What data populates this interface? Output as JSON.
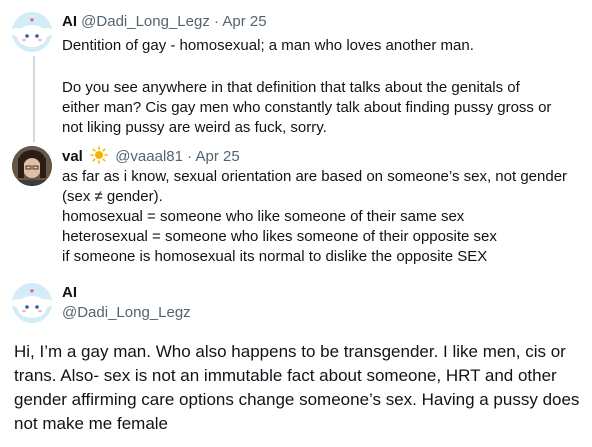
{
  "tweet1": {
    "name": "AI",
    "handle": "@Dadi_Long_Legz",
    "sep": "·",
    "date": "Apr 25",
    "line1": "Dentition of gay - homosexual; a man who loves another man.",
    "line2": "Do you see anywhere in that definition that talks about the genitals of",
    "line3": "either man? Cis gay men who constantly talk about finding pussy gross or",
    "line4": "not liking pussy are weird as fuck, sorry.",
    "avatar_icon": "cinnamoroll-avatar-icon"
  },
  "tweet2": {
    "name": "val",
    "emoji": "sun-icon",
    "handle": "@vaaal81",
    "sep": "·",
    "date": "Apr 25",
    "line1": "as far as i know, sexual orientation are based on someone’s sex, not gender",
    "line2": "(sex ≠ gender).",
    "line3": "homosexual = someone who like someone of their same sex",
    "line4": "heterosexual = someone who likes someone of their opposite sex",
    "line5": "if someone is homosexual its normal to dislike the opposite SEX",
    "avatar_icon": "person-avatar-icon"
  },
  "tweet3": {
    "name": "AI",
    "handle": "@Dadi_Long_Legz",
    "body": "Hi, I’m a gay man. Who also happens to be transgender. I like men, cis or trans. Also- sex is not an immutable fact about someone, HRT and other gender affirming care options change someone’s sex. Having a pussy does not make me female",
    "avatar_icon": "cinnamoroll-avatar-icon"
  },
  "colors": {
    "text": "#0f1419",
    "secondary": "#536471",
    "thread_line": "#cfd9de",
    "sun": "#f5b400"
  }
}
